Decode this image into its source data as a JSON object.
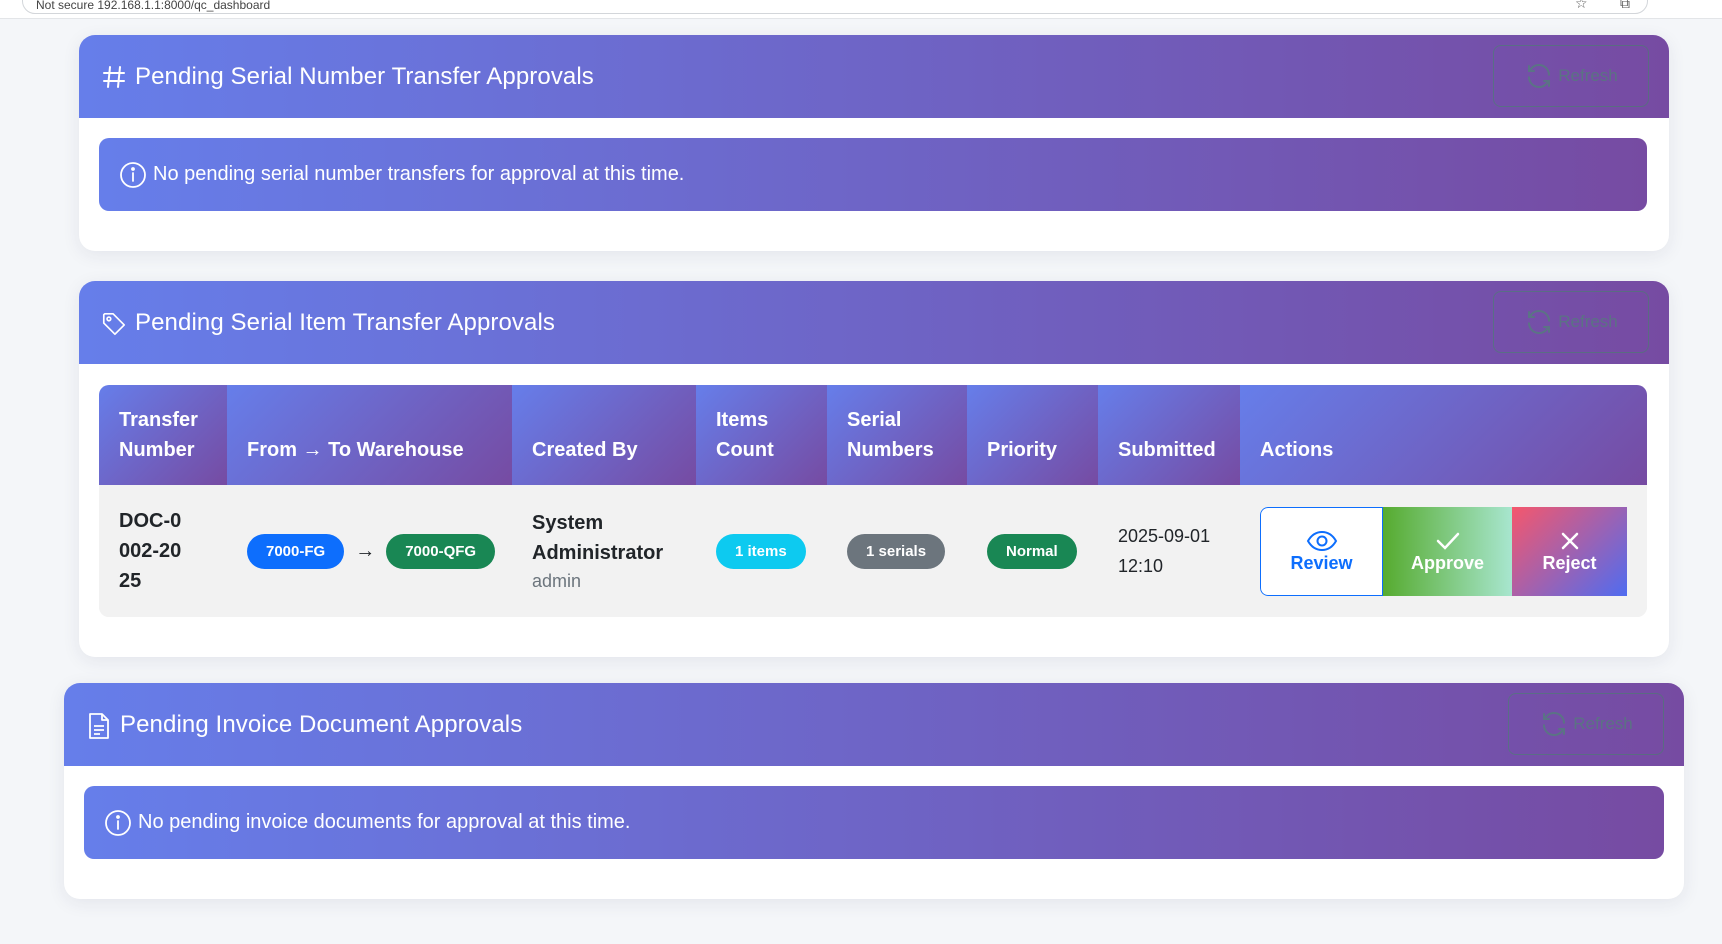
{
  "browser": {
    "address_text": "Not secure   192.168.1.1:8000/qc_dashboard"
  },
  "colors": {
    "header_gradient_start": "#667eea",
    "header_gradient_end": "#764ba2",
    "badge_blue": "#0d6efd",
    "badge_green": "#198754",
    "badge_cyan": "#0dcaf0",
    "badge_grey": "#6c757d"
  },
  "serial_number_section": {
    "icon": "hash-icon",
    "title": "Pending Serial Number Transfer Approvals",
    "refresh_label": "Refresh",
    "info_message": "No pending serial number transfers for approval at this time."
  },
  "serial_item_section": {
    "icon": "tag-icon",
    "title": "Pending Serial Item Transfer Approvals",
    "refresh_label": "Refresh",
    "columns": [
      "Transfer Number",
      "From → To Warehouse",
      "Created By",
      "Items Count",
      "Serial Numbers",
      "Priority",
      "Submitted",
      "Actions"
    ],
    "rows": [
      {
        "transfer_number": "DOC-0002-2025",
        "from_warehouse": "7000-FG",
        "arrow": "→",
        "to_warehouse": "7000-QFG",
        "created_by_name": "System Administrator",
        "created_by_user": "admin",
        "items_count": "1 items",
        "serial_numbers": "1 serials",
        "priority": "Normal",
        "submitted_date": "2025-09-01",
        "submitted_time": "12:10",
        "review_label": "Review",
        "approve_label": "Approve",
        "reject_label": "Reject"
      }
    ]
  },
  "invoice_section": {
    "icon": "document-icon",
    "title": "Pending Invoice Document Approvals",
    "refresh_label": "Refresh",
    "info_message": "No pending invoice documents for approval at this time."
  }
}
